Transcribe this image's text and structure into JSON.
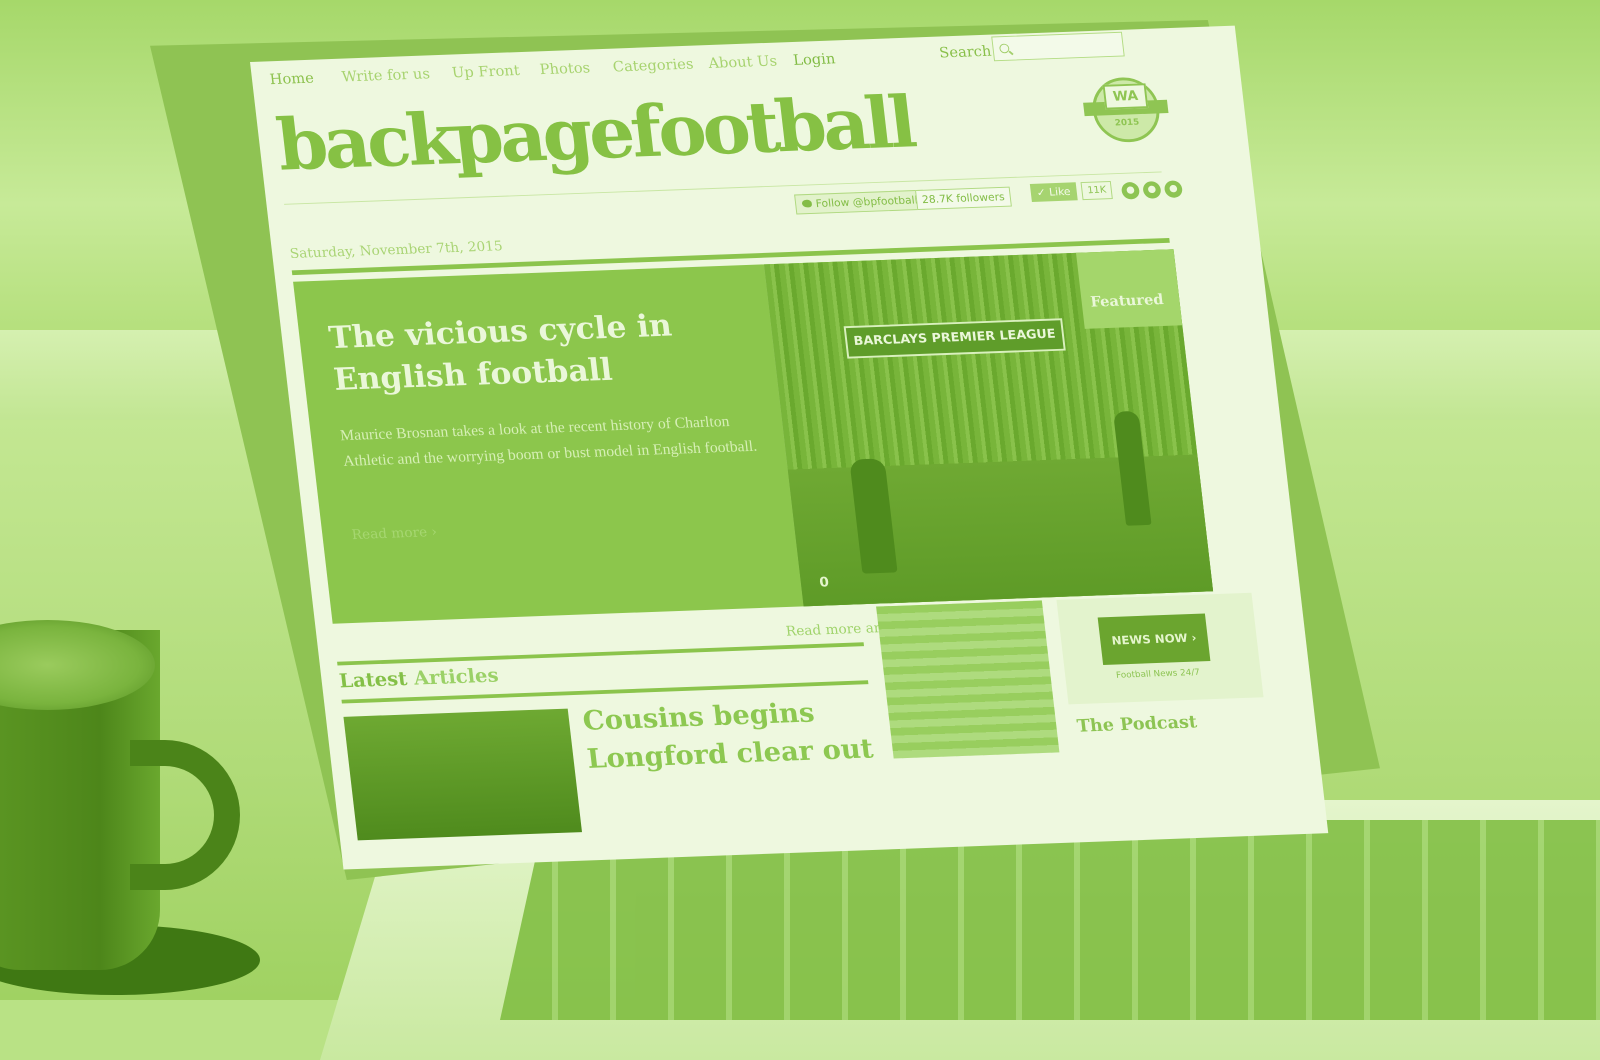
{
  "nav": {
    "items": [
      "Home",
      "Write for us",
      "Up Front",
      "Photos",
      "Categories",
      "About Us",
      "Login"
    ],
    "search_label": "Search"
  },
  "site": {
    "logo": "backpagefootball",
    "badge_text": "WA",
    "badge_year": "2015"
  },
  "social": {
    "follow_label": "Follow @bpfootball",
    "followers": "28.7K followers",
    "like_label": "Like",
    "like_count": "11K"
  },
  "date": "Saturday, November 7th, 2015",
  "hero": {
    "title": "The vicious cycle in English football",
    "excerpt": "Maurice Brosnan takes a look at the recent history of Charlton Athletic and the worrying boom or bust model in English football.",
    "read_more": "Read more ›",
    "featured": "Featured",
    "banner": "BARCLAYS PREMIER LEAGUE",
    "comment_count": "0"
  },
  "latest": {
    "read_more_link": "Read more articles ›",
    "heading_part1": "Latest",
    "heading_part2": "Articles",
    "article_title": "Cousins begins Longford clear out"
  },
  "sidebar": {
    "ad_label": "NEWS NOW ›",
    "ad_caption": "Football News 24/7",
    "podcast_heading": "The Podcast"
  },
  "colors": {
    "tint": "#b9e285",
    "accent": "#8bc44c"
  }
}
